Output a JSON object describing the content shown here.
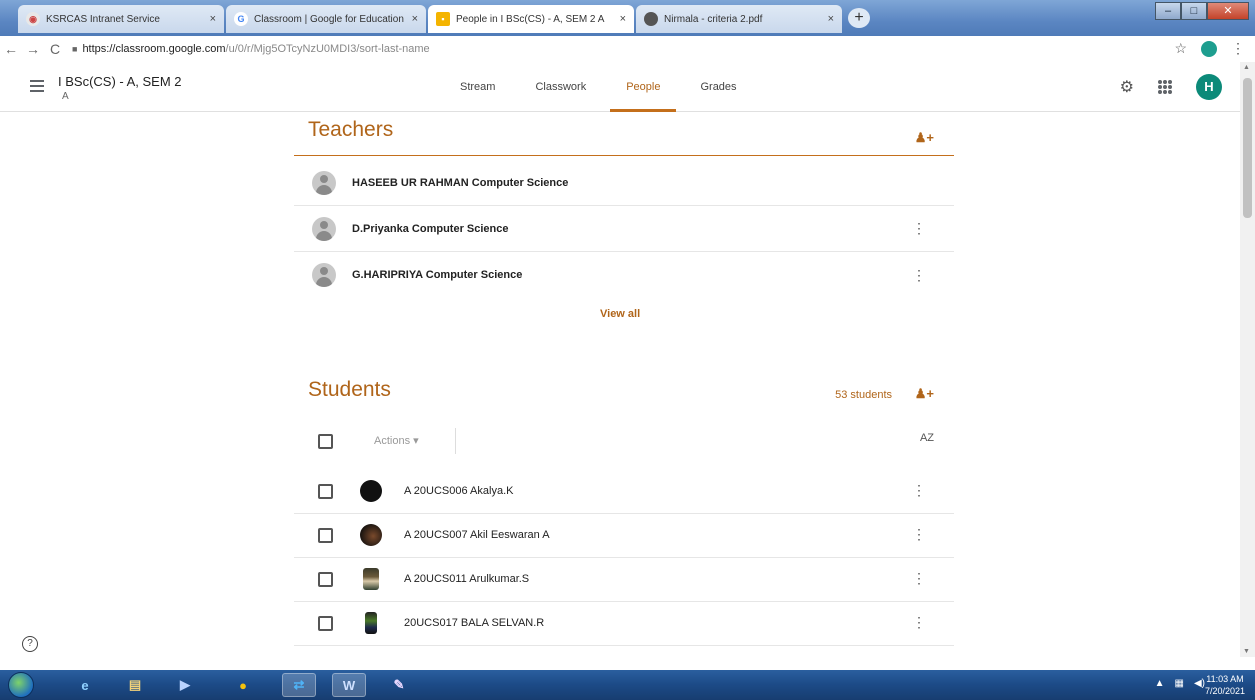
{
  "browser": {
    "tabs": [
      {
        "title": "KSRCAS Intranet Service",
        "close": "×",
        "fav_color": "#ffffff"
      },
      {
        "title": "Classroom | Google for Education",
        "close": "×",
        "fav_color": "#ffffff"
      },
      {
        "title": "People in I BSc(CS) - A, SEM 2 A",
        "close": "×",
        "fav_color": "#f4b400",
        "active": true
      },
      {
        "title": "Nirmala - criteria 2.pdf",
        "close": "×",
        "fav_color": "#444444"
      }
    ],
    "newtab": "+",
    "url_host": "https://classroom.google.com",
    "url_path": "/u/0/r/Mjg5OTcyNzU0MDI3/sort-last-name"
  },
  "header": {
    "class_name": "I BSc(CS) - A, SEM 2",
    "section": "A",
    "nav": [
      {
        "label": "Stream"
      },
      {
        "label": "Classwork"
      },
      {
        "label": "People",
        "active": true
      },
      {
        "label": "Grades"
      }
    ],
    "avatar_letter": "H"
  },
  "teachers": {
    "title": "Teachers",
    "rows": [
      {
        "name": "HASEEB UR RAHMAN Computer Science"
      },
      {
        "name": "D.Priyanka Computer Science"
      },
      {
        "name": "G.HARIPRIYA Computer Science"
      }
    ],
    "view_all": "View all"
  },
  "students": {
    "title": "Students",
    "count": "53 students",
    "actions_label": "Actions",
    "sort_label": "AZ",
    "rows": [
      {
        "name": "A 20UCS006 Akalya.K"
      },
      {
        "name": "A 20UCS007 Akil Eeswaran A"
      },
      {
        "name": "A 20UCS011 Arulkumar.S"
      },
      {
        "name": "20UCS017 BALA SELVAN.R"
      }
    ]
  },
  "taskbar": {
    "time": "11:03 AM",
    "date": "7/20/2021"
  },
  "colors": {
    "accent": "#b0651a",
    "avatar": "#0c8a79"
  }
}
